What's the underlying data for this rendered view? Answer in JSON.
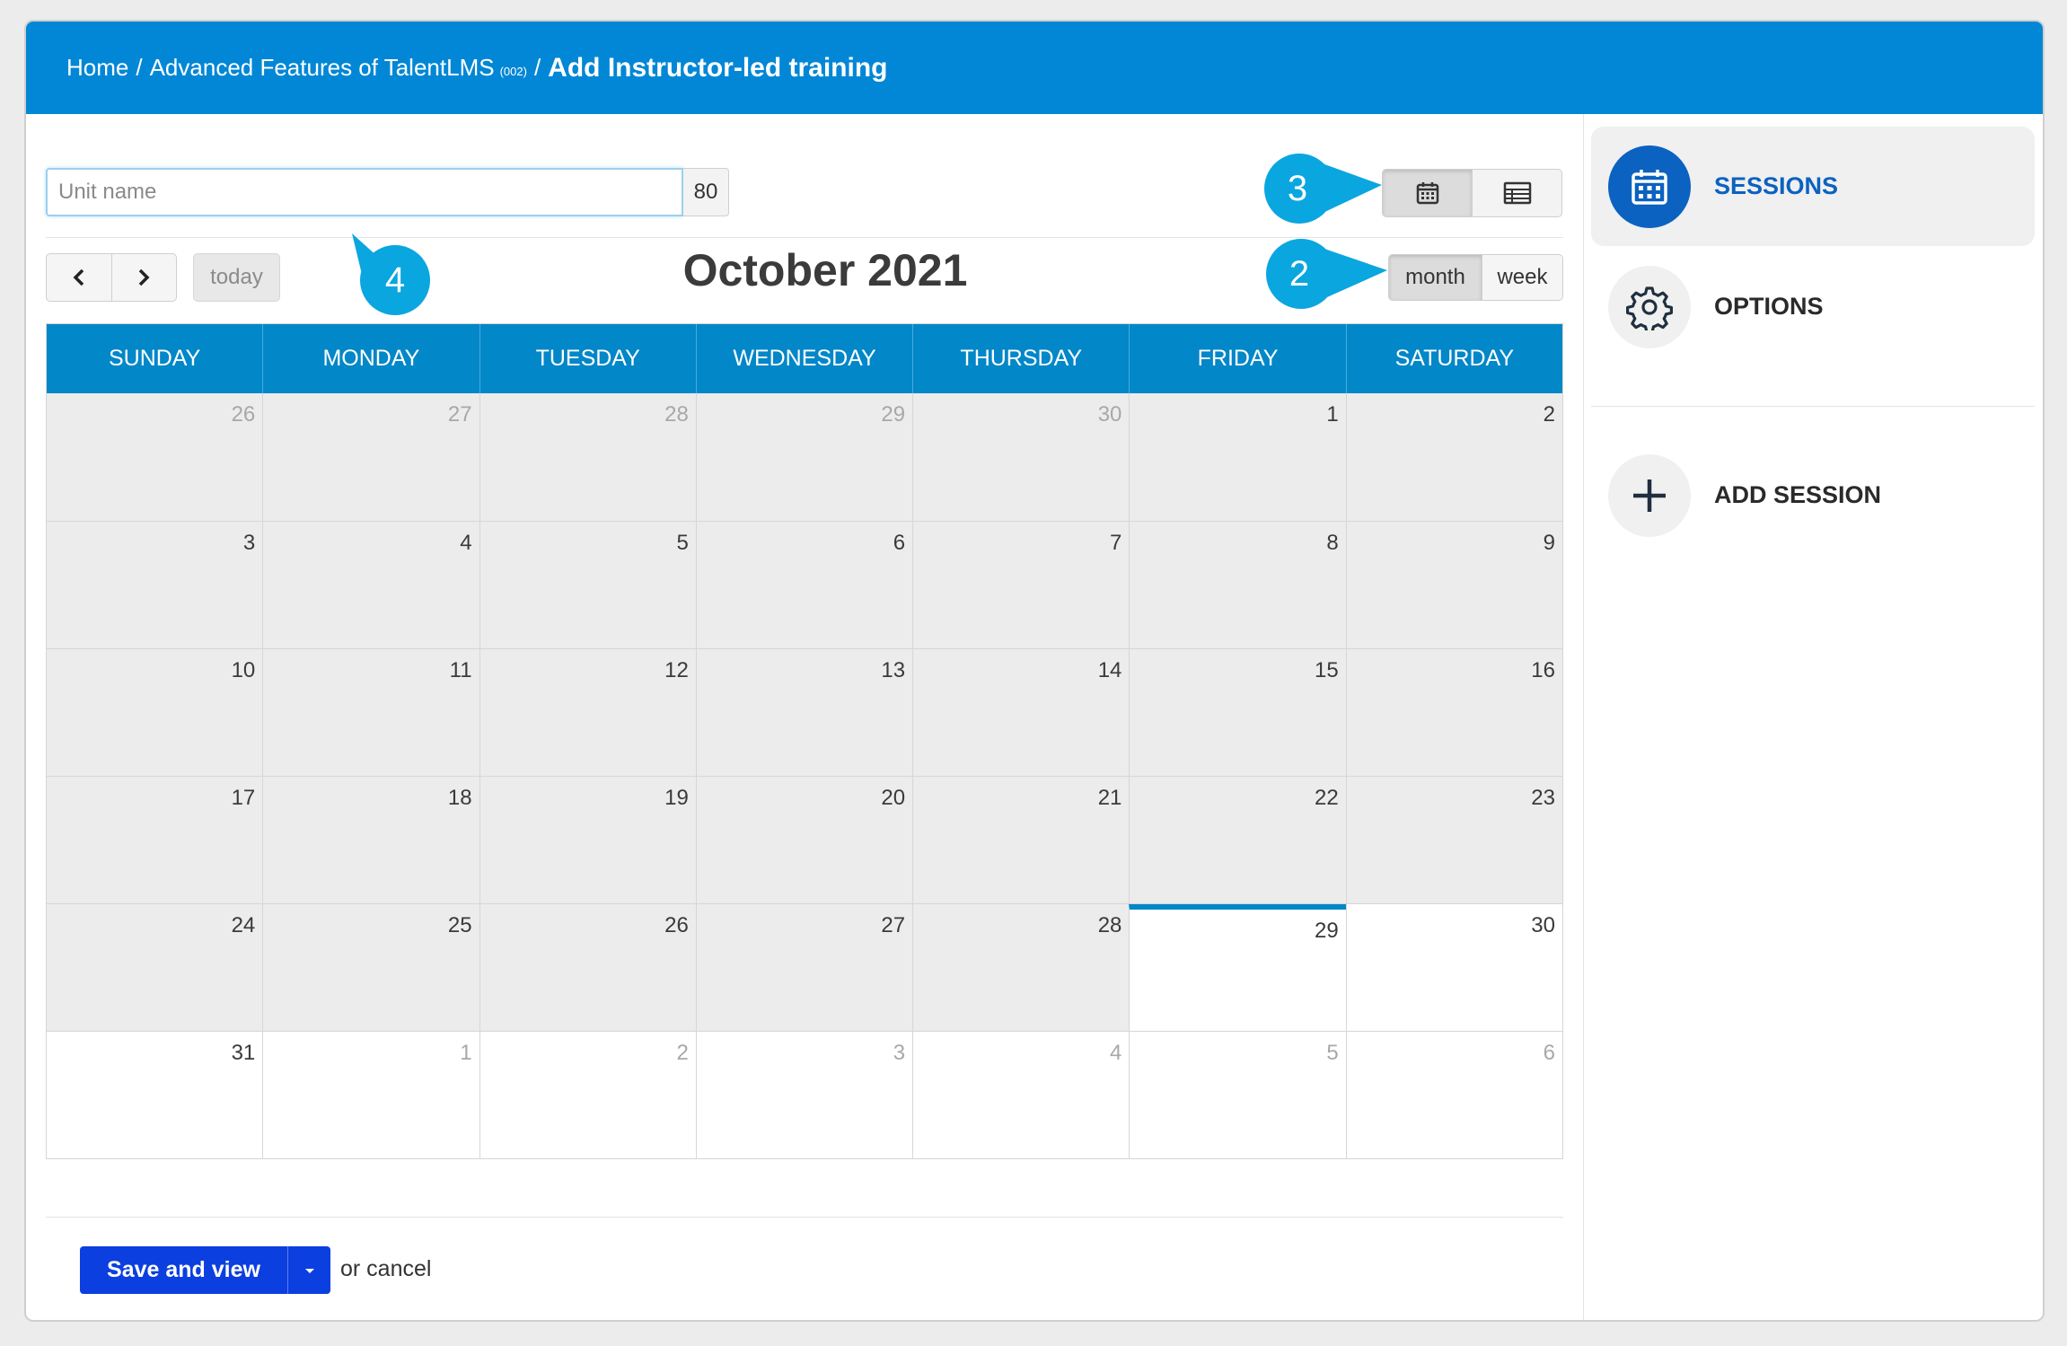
{
  "breadcrumb": {
    "home": "Home",
    "course": "Advanced Features of TalentLMS",
    "course_code": "(002)",
    "separator": "/",
    "current": "Add Instructor-led training"
  },
  "unit": {
    "placeholder": "Unit name",
    "value": "",
    "char_limit": "80"
  },
  "view_toggle": {
    "options": [
      "calendar-icon",
      "table-icon"
    ],
    "active": "calendar-icon"
  },
  "calendar": {
    "title": "October 2021",
    "today_label": "today",
    "prev_icon": "chevron-left-icon",
    "next_icon": "chevron-right-icon",
    "view_options": {
      "month": "month",
      "week": "week",
      "active": "month"
    },
    "headers": [
      "SUNDAY",
      "MONDAY",
      "TUESDAY",
      "WEDNESDAY",
      "THURSDAY",
      "FRIDAY",
      "SATURDAY"
    ],
    "weeks": [
      [
        "26",
        "27",
        "28",
        "29",
        "30",
        "1",
        "2"
      ],
      [
        "3",
        "4",
        "5",
        "6",
        "7",
        "8",
        "9"
      ],
      [
        "10",
        "11",
        "12",
        "13",
        "14",
        "15",
        "16"
      ],
      [
        "17",
        "18",
        "19",
        "20",
        "21",
        "22",
        "23"
      ],
      [
        "24",
        "25",
        "26",
        "27",
        "28",
        "29",
        "30"
      ],
      [
        "31",
        "1",
        "2",
        "3",
        "4",
        "5",
        "6"
      ]
    ],
    "today_date": "29"
  },
  "annotations": [
    "3",
    "2",
    "4"
  ],
  "footer": {
    "save_label": "Save and view",
    "cancel_text": "or cancel"
  },
  "sidebar": {
    "items": [
      {
        "label": "SESSIONS",
        "icon": "calendar-icon",
        "active": true
      },
      {
        "label": "OPTIONS",
        "icon": "gear-icon",
        "active": false
      },
      {
        "label": "ADD SESSION",
        "icon": "plus-icon",
        "active": false
      }
    ]
  },
  "colors": {
    "header_bg": "#0287d6",
    "calendar_header": "#0287c8",
    "primary_button": "#0c3fe0",
    "sidebar_active": "#0b62c1",
    "annotation": "#0aa6e0"
  }
}
